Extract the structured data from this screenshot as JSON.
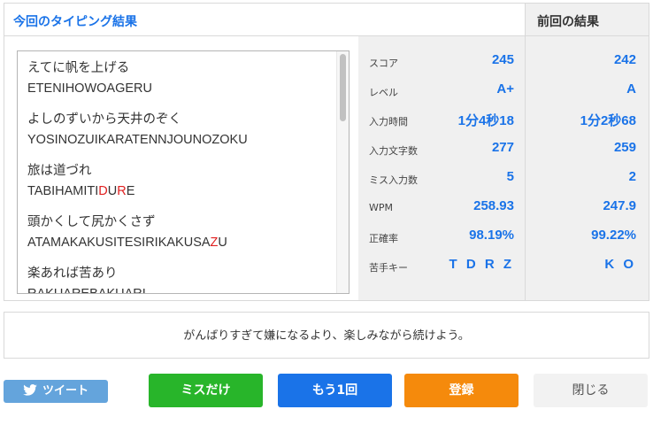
{
  "header": {
    "current_title": "今回のタイピング結果",
    "previous_title": "前回の結果"
  },
  "words": [
    {
      "jp": "えてに帆を上げる",
      "romaji": [
        {
          "t": "ETENIHOWOAGERU",
          "miss": false
        }
      ]
    },
    {
      "jp": "よしのずいから天井のぞく",
      "romaji": [
        {
          "t": "YOSINOZUIKARATENNJOUNOZOKU",
          "miss": false
        }
      ]
    },
    {
      "jp": "旅は道づれ",
      "romaji": [
        {
          "t": "TABIHAMITI",
          "miss": false
        },
        {
          "t": "D",
          "miss": true
        },
        {
          "t": "U",
          "miss": false
        },
        {
          "t": "R",
          "miss": true
        },
        {
          "t": "E",
          "miss": false
        }
      ]
    },
    {
      "jp": "頭かくして尻かくさず",
      "romaji": [
        {
          "t": "ATAMAKAKUSITESIRIKAKUSA",
          "miss": false
        },
        {
          "t": "Z",
          "miss": true
        },
        {
          "t": "U",
          "miss": false
        }
      ]
    },
    {
      "jp": "楽あれば苦あり",
      "romaji": [
        {
          "t": "RAKUAREBAKUARI",
          "miss": false
        }
      ]
    }
  ],
  "stats": [
    {
      "label": "スコア",
      "current": "245",
      "previous": "242"
    },
    {
      "label": "レベル",
      "current": "A+",
      "previous": "A"
    },
    {
      "label": "入力時間",
      "current": "1分4秒18",
      "previous": "1分2秒68"
    },
    {
      "label": "入力文字数",
      "current": "277",
      "previous": "259"
    },
    {
      "label": "ミス入力数",
      "current": "5",
      "previous": "2"
    },
    {
      "label": "WPM",
      "current": "258.93",
      "previous": "247.9"
    },
    {
      "label": "正確率",
      "current": "98.19%",
      "previous": "99.22%"
    },
    {
      "label": "苦手キー",
      "current": "T D R Z",
      "previous": "K O"
    }
  ],
  "message": "がんばりすぎて嫌になるより、楽しみながら続けよう。",
  "buttons": {
    "tweet": "ツイート",
    "miss_only": "ミスだけ",
    "again": "もう1回",
    "register": "登録",
    "close": "閉じる"
  },
  "colors": {
    "accent": "#1a73e8",
    "miss": "#e02020",
    "green": "#28b52a",
    "orange": "#f58a0c",
    "twitter": "#64a4dc"
  }
}
